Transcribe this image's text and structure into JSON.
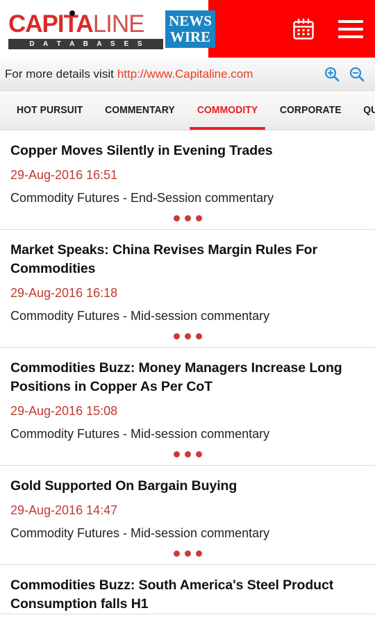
{
  "header": {
    "logo": {
      "brand_part1": "CAPITA",
      "brand_part2": "LINE",
      "tagline": "D A T A B A S E S",
      "badge_line1": "NEWS",
      "badge_line2": "WIRE"
    },
    "calendar_icon": "calendar-icon",
    "menu_icon": "hamburger-menu-icon",
    "background_color": "#ff0000"
  },
  "subheader": {
    "text": "For more details visit",
    "link_text": "http://www.Capitaline.com",
    "link_color": "#ef3a24",
    "zoom_in_icon": "zoom-in-icon",
    "zoom_out_icon": "zoom-out-icon",
    "icon_color": "#2f8fd8"
  },
  "tabs": {
    "active_index": 2,
    "accent_color": "#ed1c24",
    "items": [
      {
        "label": "HOT PURSUIT"
      },
      {
        "label": "COMMENTARY"
      },
      {
        "label": "COMMODITY"
      },
      {
        "label": "CORPORATE"
      },
      {
        "label": "QUOTES"
      }
    ]
  },
  "news": {
    "more_icon": "more-dots-icon",
    "items": [
      {
        "title": "Copper Moves Silently in Evening Trades",
        "date": "29-Aug-2016 16:51",
        "category": "Commodity Futures - End-Session commentary"
      },
      {
        "title": "Market Speaks: China Revises Margin Rules For Commodities",
        "date": "29-Aug-2016 16:18",
        "category": "Commodity Futures - Mid-session commentary"
      },
      {
        "title": "Commodities Buzz: Money Managers Increase Long Positions in Copper As Per CoT",
        "date": "29-Aug-2016 15:08",
        "category": "Commodity Futures - Mid-session commentary"
      },
      {
        "title": "Gold Supported On Bargain Buying",
        "date": "29-Aug-2016 14:47",
        "category": "Commodity Futures - Mid-session commentary"
      },
      {
        "title": "Commodities Buzz: South America's Steel Product Consumption falls H1",
        "date": "",
        "category": ""
      }
    ]
  }
}
